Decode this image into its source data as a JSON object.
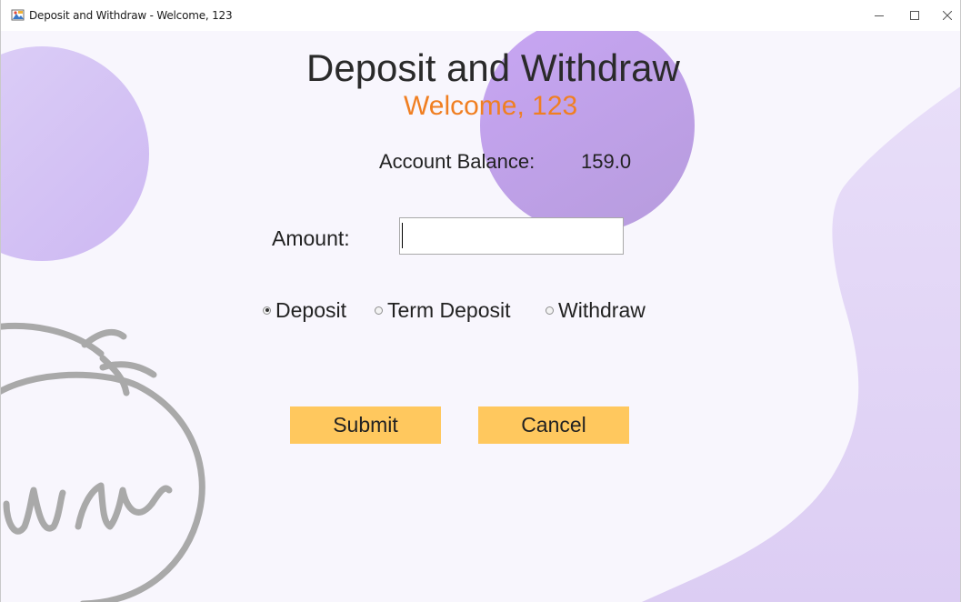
{
  "window": {
    "title": "Deposit and Withdraw - Welcome, 123"
  },
  "header": {
    "title": "Deposit and Withdraw",
    "welcome": "Welcome, 123"
  },
  "balance": {
    "label": "Account Balance:",
    "value": "159.0"
  },
  "form": {
    "amount_label": "Amount:",
    "amount_value": "",
    "options": [
      {
        "label": "Deposit",
        "selected": true
      },
      {
        "label": "Term Deposit",
        "selected": false
      },
      {
        "label": "Withdraw",
        "selected": false
      }
    ],
    "submit_label": "Submit",
    "cancel_label": "Cancel"
  },
  "icons": {
    "app": "java-app-icon",
    "minimize": "minimize-icon",
    "maximize": "maximize-icon",
    "close": "close-icon"
  },
  "colors": {
    "background": "#f8f6fd",
    "accent_orange": "#f07f22",
    "button_yellow": "#ffc85e",
    "blob_purple": "#c3a4ee"
  }
}
